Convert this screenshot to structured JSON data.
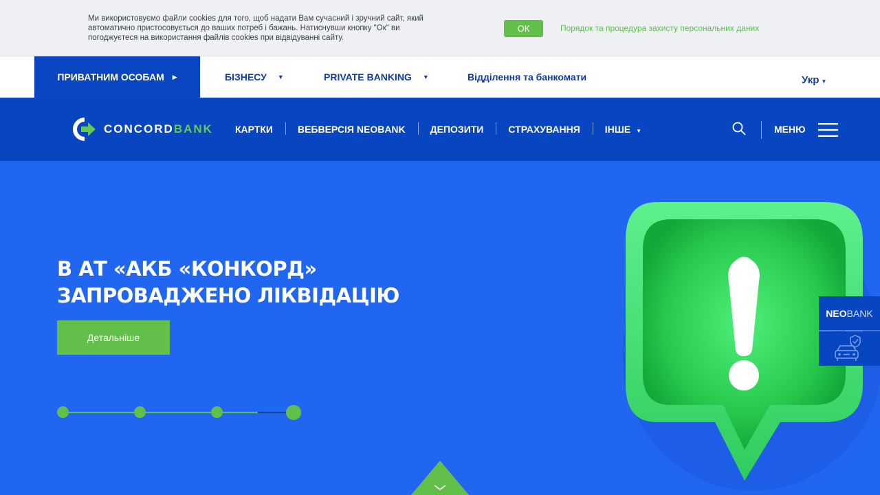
{
  "cookie": {
    "line1": "Ми використовуємо файли cookies для того, щоб надати Вам сучасний і зручний сайт, який",
    "line2": "автоматично пристосовується до ваших потреб і бажань. Натиснувши кнопку \"Ок\" ви",
    "line3": "погоджуєтеся на використання файлів cookies при відвідуванні сайту.",
    "ok_label": "ОК",
    "privacy_link": "Порядок та процедура захисту персональних даних"
  },
  "top_nav": {
    "items": [
      {
        "label": "ПРИВАТНИМ ОСОБАМ",
        "active": true
      },
      {
        "label": "БІЗНЕСУ"
      },
      {
        "label": "PRIVATE BANKING"
      },
      {
        "label": "Відділення та банкомати"
      }
    ],
    "language": "Укр"
  },
  "header": {
    "logo_main": "CONCORD",
    "logo_accent": "BANK",
    "nav": [
      {
        "label": "КАРТКИ"
      },
      {
        "label": "ВЕБВЕРСІЯ NEOBANK"
      },
      {
        "label": "ДЕПОЗИТИ"
      },
      {
        "label": "СТРАХУВАННЯ"
      },
      {
        "label": "ІНШЕ"
      }
    ],
    "menu_label": "МЕНЮ"
  },
  "hero": {
    "title_line1": "В АТ «АКБ «КОНКОРД»",
    "title_line2": "ЗАПРОВАДЖЕНО ЛІКВІДАЦІЮ",
    "button_label": "Детальніше",
    "slides_count": 4,
    "active_slide": 4
  },
  "side": {
    "neo_bold": "NEO",
    "neo_light": "BANK"
  },
  "colors": {
    "primary_blue": "#0846c1",
    "hero_blue": "#2166f0",
    "accent_green": "#62c04a"
  }
}
